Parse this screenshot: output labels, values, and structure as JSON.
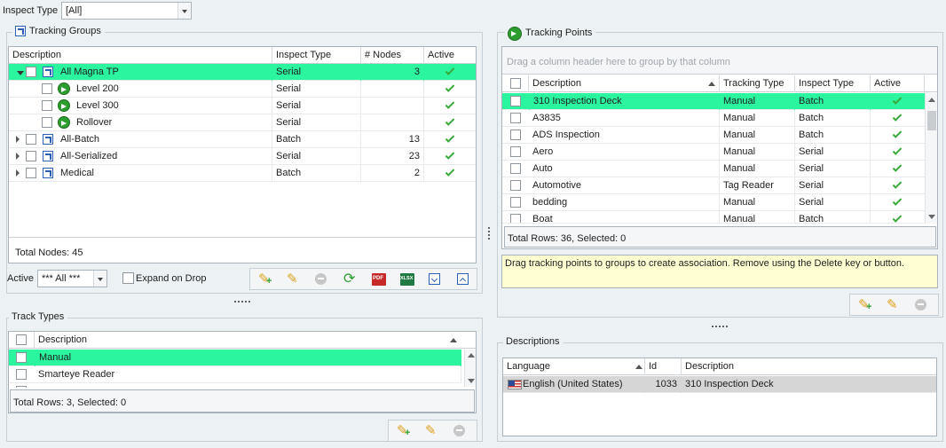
{
  "inspect_type": {
    "label": "Inspect Type",
    "value": "[All]"
  },
  "tracking_groups": {
    "title": "Tracking Groups",
    "columns": [
      "Description",
      "Inspect Type",
      "# Nodes",
      "Active"
    ],
    "rows": [
      {
        "description": "All Magna TP",
        "inspect_type": "Serial",
        "nodes": "3",
        "level": 0,
        "expanded": true,
        "icon": "group-icon"
      },
      {
        "description": "Level 200",
        "inspect_type": "Serial",
        "nodes": "",
        "level": 1,
        "icon": "tracking-point-icon"
      },
      {
        "description": "Level 300",
        "inspect_type": "Serial",
        "nodes": "",
        "level": 1,
        "icon": "tracking-point-icon"
      },
      {
        "description": "Rollover",
        "inspect_type": "Serial",
        "nodes": "",
        "level": 1,
        "icon": "tracking-point-icon"
      },
      {
        "description": "All-Batch",
        "inspect_type": "Batch",
        "nodes": "13",
        "level": 0,
        "expanded": false,
        "icon": "group-icon"
      },
      {
        "description": "All-Serialized",
        "inspect_type": "Serial",
        "nodes": "23",
        "level": 0,
        "expanded": false,
        "icon": "group-icon"
      },
      {
        "description": "Medical",
        "inspect_type": "Batch",
        "nodes": "2",
        "level": 0,
        "expanded": false,
        "icon": "group-icon"
      }
    ],
    "total_nodes": "Total Nodes: 45",
    "active_label": "Active",
    "active_value": "*** All ***",
    "expand_on_drop": "Expand on Drop"
  },
  "track_types": {
    "title": "Track Types",
    "columns": [
      "Description"
    ],
    "rows": [
      "Manual",
      "Smarteye Reader"
    ],
    "status": "Total Rows: 3, Selected: 0"
  },
  "tracking_points": {
    "title": "Tracking Points",
    "group_panel": "Drag a column header here to group by that column",
    "columns": [
      "Description",
      "Tracking Type",
      "Inspect Type",
      "Active"
    ],
    "rows": [
      {
        "description": "310 Inspection Deck",
        "tracking_type": "Manual",
        "inspect_type": "Batch"
      },
      {
        "description": "A3835",
        "tracking_type": "Manual",
        "inspect_type": "Batch"
      },
      {
        "description": "ADS Inspection",
        "tracking_type": "Manual",
        "inspect_type": "Batch"
      },
      {
        "description": "Aero",
        "tracking_type": "Manual",
        "inspect_type": "Serial"
      },
      {
        "description": "Auto",
        "tracking_type": "Manual",
        "inspect_type": "Serial"
      },
      {
        "description": "Automotive",
        "tracking_type": "Tag Reader",
        "inspect_type": "Serial"
      },
      {
        "description": "bedding",
        "tracking_type": "Manual",
        "inspect_type": "Serial"
      },
      {
        "description": "Boat",
        "tracking_type": "Manual",
        "inspect_type": "Batch"
      }
    ],
    "status": "Total Rows: 36, Selected: 0",
    "hint": "Drag tracking points to groups to create association.  Remove using the Delete key or button."
  },
  "descriptions": {
    "title": "Descriptions",
    "columns": [
      "Language",
      "Id",
      "Description"
    ],
    "rows": [
      {
        "language": "English (United States)",
        "id": "1033",
        "description": "310 Inspection Deck"
      }
    ]
  }
}
